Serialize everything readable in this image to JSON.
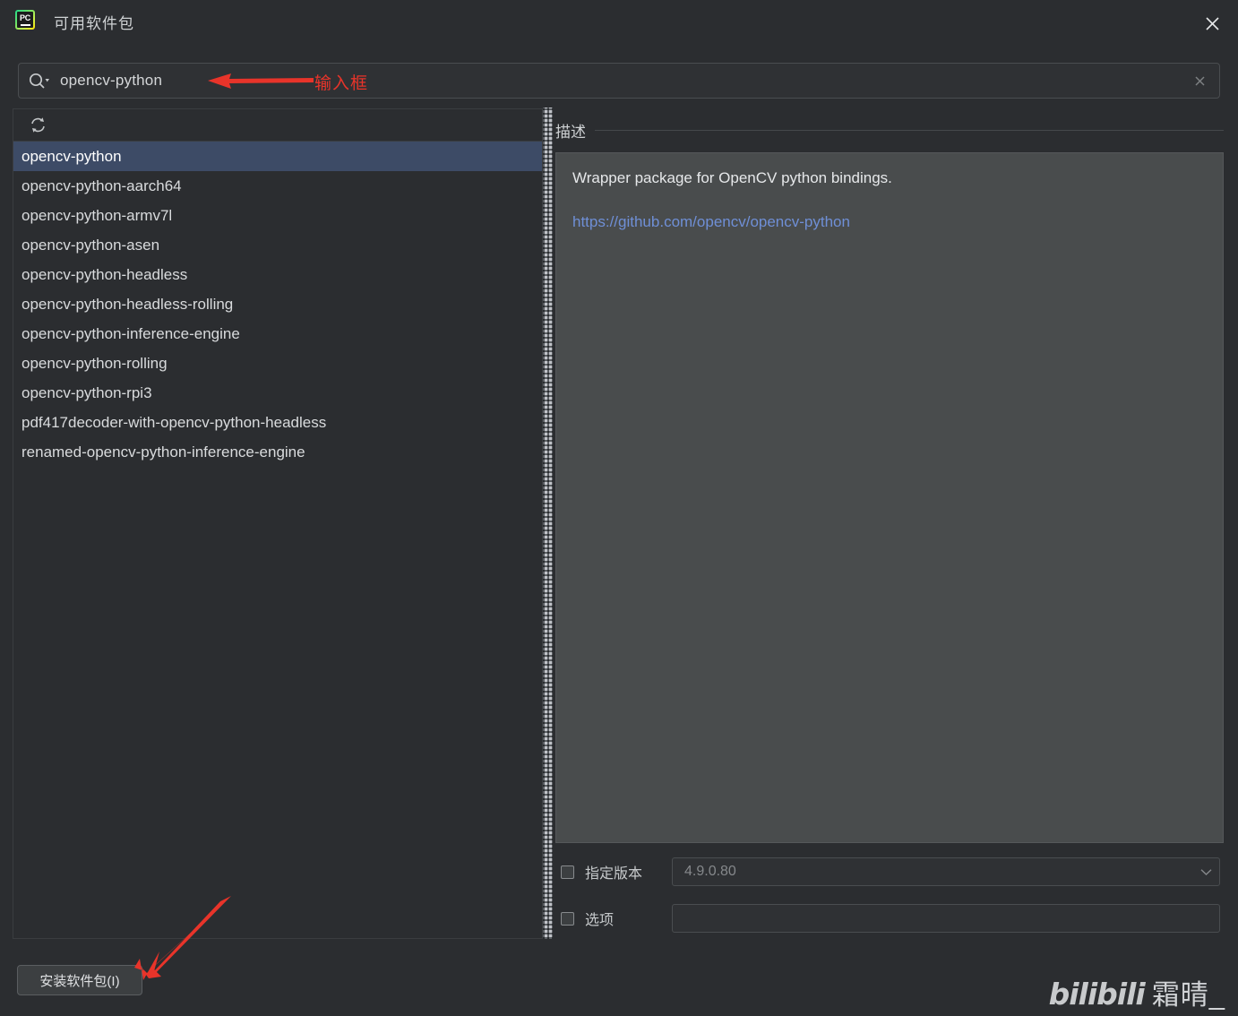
{
  "window": {
    "title": "可用软件包",
    "logo_text": "PC",
    "close_icon": "close-icon"
  },
  "search": {
    "value": "opencv-python",
    "placeholder": "",
    "search_icon": "search-icon",
    "clear_icon": "clear-icon"
  },
  "annotations": {
    "input_label": "输入框",
    "arrow_color": "#e8342a"
  },
  "list_toolbar": {
    "refresh_icon": "refresh-icon"
  },
  "packages": [
    {
      "name": "opencv-python",
      "selected": true
    },
    {
      "name": "opencv-python-aarch64",
      "selected": false
    },
    {
      "name": "opencv-python-armv7l",
      "selected": false
    },
    {
      "name": "opencv-python-asen",
      "selected": false
    },
    {
      "name": "opencv-python-headless",
      "selected": false
    },
    {
      "name": "opencv-python-headless-rolling",
      "selected": false
    },
    {
      "name": "opencv-python-inference-engine",
      "selected": false
    },
    {
      "name": "opencv-python-rolling",
      "selected": false
    },
    {
      "name": "opencv-python-rpi3",
      "selected": false
    },
    {
      "name": "pdf417decoder-with-opencv-python-headless",
      "selected": false
    },
    {
      "name": "renamed-opencv-python-inference-engine",
      "selected": false
    }
  ],
  "description": {
    "header": "描述",
    "text": "Wrapper package for OpenCV python bindings.",
    "link": "https://github.com/opencv/opencv-python",
    "link_color": "#6f8fd6"
  },
  "options": {
    "version": {
      "label": "指定版本",
      "checked": false,
      "value": "4.9.0.80",
      "caret_icon": "chevron-down-icon"
    },
    "extra": {
      "label": "选项",
      "checked": false,
      "value": ""
    }
  },
  "install_button": {
    "label": "安装软件包(I)"
  },
  "watermark": {
    "brand": "bilibili",
    "name": "霜晴_"
  },
  "colors": {
    "dialog_bg": "#2b2d30",
    "panel_border": "#3a3d40",
    "selection_blue": "#3d4b66",
    "desc_bg": "#494c4d",
    "accent_red": "#e8342a"
  }
}
